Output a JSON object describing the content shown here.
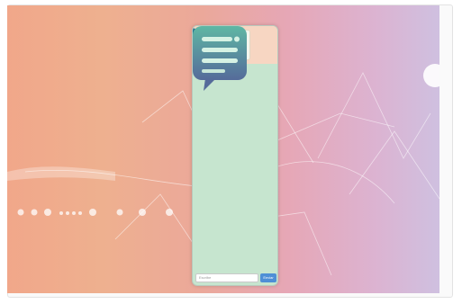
{
  "app": {
    "input_placeholder": "Escribe",
    "send_label": "Enviar"
  },
  "colors": {
    "accent": "#4e8fd6",
    "phone_body": "#c6e5cf",
    "phone_header": "#f7d6c2"
  },
  "icons": [
    "logo-emblem",
    "leaf-left-icon",
    "leaf-right-icon",
    "chat-bubble-icon"
  ]
}
